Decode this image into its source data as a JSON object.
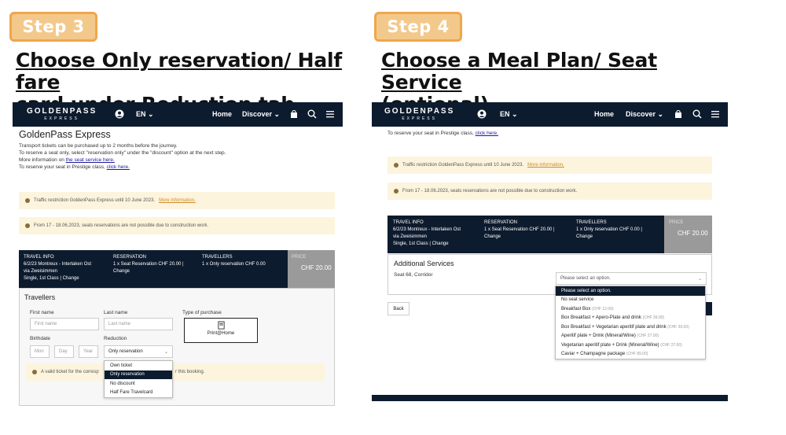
{
  "left": {
    "badge": "Step 3",
    "heading_line1": "Choose Only reservation/ Half fare",
    "heading_line2": "card under Reduction tab",
    "nav": {
      "logo": "GOLDENPASS",
      "logo_sub": "EXPRESS",
      "lang": "EN",
      "home": "Home",
      "discover": "Discover"
    },
    "page_title": "GoldenPass Express",
    "intro": [
      "Transport tickets can be purchased up to 2 months before the journey.",
      "To reserve a seat only, select \"reservation only\" under the \"discount\" option at the next step."
    ],
    "more_info_prefix": "More information on ",
    "more_info_link": "the seat service here.",
    "prestige_prefix": "To reserve your seat in Prestige class, ",
    "prestige_link": "click here.",
    "notice1_text": "Traffic restriction GoldenPass Express until 10 June 2023.",
    "notice1_link": "More information.",
    "notice2_text": "From 17 - 18.06.2023, seats reservations are not possible due to construction work.",
    "summary": {
      "travel_info_h": "TRAVEL INFO",
      "travel_info_1": "6/2/23 Montreux - Interlaken Ost",
      "travel_info_2": "via  Zweisimmen",
      "travel_info_3": "Single, 1st Class | Change",
      "reservation_h": "RESERVATION",
      "reservation_1": "1 x Seat Reservation CHF 20.00 |",
      "reservation_2": "Change",
      "travellers_h": "TRAVELLERS",
      "travellers_1": "1 x Only reservation CHF 0.00",
      "price_h": "PRICE",
      "price": "CHF 20.00"
    },
    "travellers_title": "Travellers",
    "first_name_label": "First name",
    "first_name_ph": "First name",
    "last_name_label": "Last name",
    "last_name_ph": "Last name",
    "purchase_label": "Type of purchase",
    "print_home": "Print@Home",
    "birthdate_label": "Birthdate",
    "mon": "Mon",
    "day": "Day",
    "year": "Year",
    "reduction_label": "Reduction",
    "reduction_value": "Only reservation",
    "valid_notice_a": "A valid ticket for the corresp",
    "valid_notice_b": "r this booking.",
    "options": [
      "Own ticket",
      "Only reservation",
      "No discount",
      "Half Fare Travelcard"
    ]
  },
  "right": {
    "badge": "Step 4",
    "heading_line1": "Choose a Meal Plan/ Seat Service",
    "heading_line2": "(optional)",
    "nav": {
      "logo": "GOLDENPASS",
      "logo_sub": "EXPRESS",
      "lang": "EN",
      "home": "Home",
      "discover": "Discover"
    },
    "prestige_prefix": "To reserve your seat in Prestige class, ",
    "prestige_link": "click here.",
    "notice1_text": "Traffic restriction GoldenPass Express until 10 June 2023.",
    "notice1_link": "More information.",
    "notice2_text": "From 17 - 18.06.2023, seats reservations are not possible due to construction work.",
    "summary": {
      "travel_info_h": "TRAVEL INFO",
      "travel_info_1": "6/2/23 Montreux - Interlaken Ost",
      "travel_info_2": "via  Zweisimmen",
      "travel_info_3": "Single, 1st Class | Change",
      "reservation_h": "RESERVATION",
      "reservation_1": "1 x Seat Reservation CHF 20.00 |",
      "reservation_2": "Change",
      "travellers_h": "TRAVELLERS",
      "travellers_1": "1 x Only reservation CHF 0.00  |",
      "travellers_2": "Change",
      "price_h": "PRICE",
      "price": "CHF 20.00"
    },
    "additional_title": "Additional Services",
    "seat_label": "Seat 68, Corridor",
    "select_ph": "Please select an option.",
    "back": "Back",
    "options": [
      {
        "label": "Please select an option.",
        "price": ""
      },
      {
        "label": "No seat service",
        "price": ""
      },
      {
        "label": "Breakfast Box",
        "price": "(CHF 12.00)"
      },
      {
        "label": "Box Breakfast + Apero-Plate and drink",
        "price": "(CHF 39.00)"
      },
      {
        "label": "Box Breakfast + Vegetarian aperitif plate and drink",
        "price": "(CHF 39.00)"
      },
      {
        "label": "Aperitif plate + Drink (Mineral/Wine)",
        "price": "(CHF 27.00)"
      },
      {
        "label": "Vegetarian aperitif plate + Drink (Mineral/Wine)",
        "price": "(CHF 27.00)"
      },
      {
        "label": "Caviar + Champagne package",
        "price": "(CHF 89.00)"
      }
    ]
  }
}
